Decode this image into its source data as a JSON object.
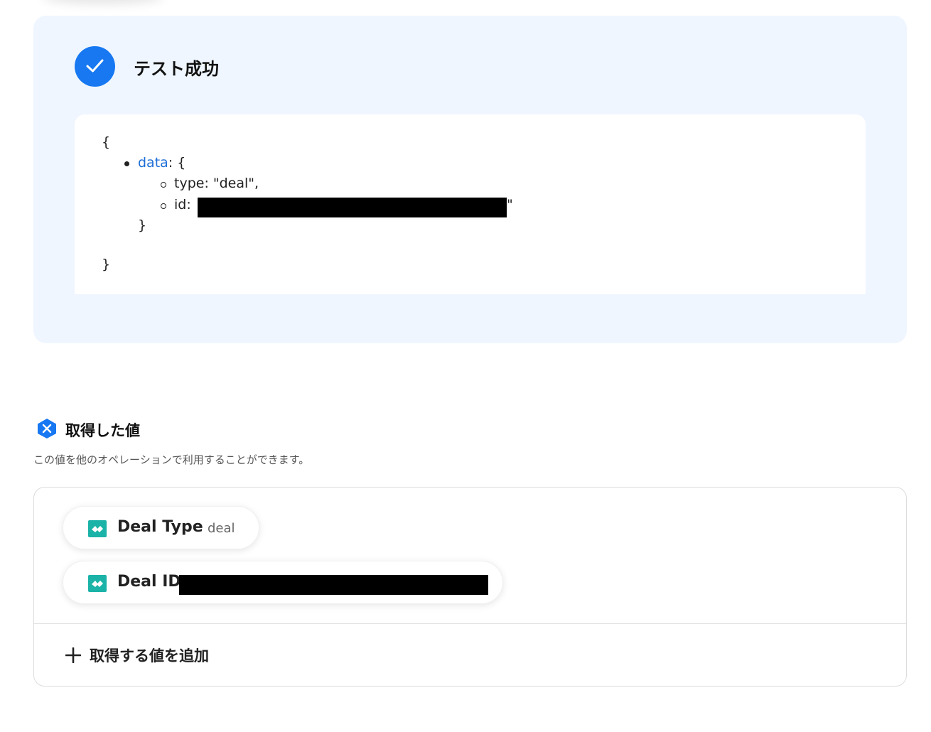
{
  "result": {
    "title": "テスト成功",
    "icon": "check-icon",
    "accent_color": "#1778f2",
    "json_preview": {
      "open_brace": "{",
      "data_key": "data",
      "data_suffix": ": {",
      "type_line": "type: \"deal\",",
      "id_label": "id:",
      "id_trailing_quote": "\"",
      "inner_close": "}",
      "outer_close": "}"
    }
  },
  "values_section": {
    "icon": "variable-hexagon-icon",
    "title": "取得した値",
    "description": "この値を他のオペレーションで利用することができます。",
    "items": [
      {
        "icon": "app-logo-icon",
        "label": "Deal Type",
        "value": "deal"
      },
      {
        "icon": "app-logo-icon",
        "label": "Deal ID",
        "value": ""
      }
    ],
    "add_button_label": "取得する値を追加"
  }
}
